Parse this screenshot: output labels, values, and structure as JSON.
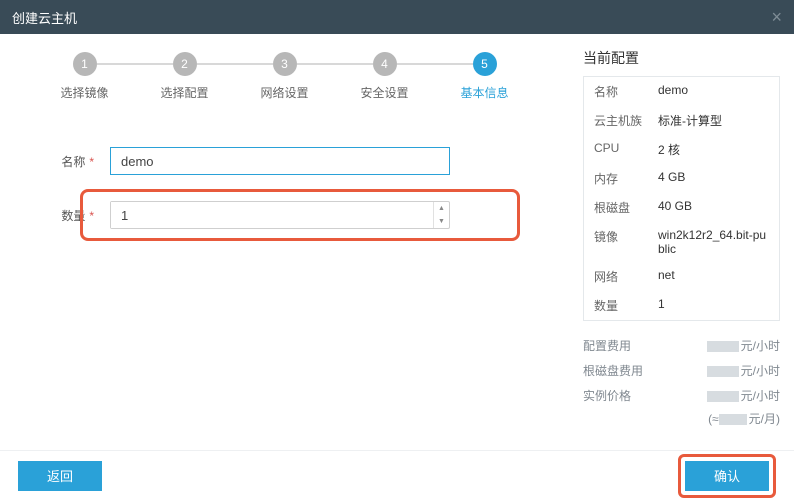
{
  "dialog": {
    "title": "创建云主机"
  },
  "steps": [
    {
      "num": "1",
      "label": "选择镜像"
    },
    {
      "num": "2",
      "label": "选择配置"
    },
    {
      "num": "3",
      "label": "网络设置"
    },
    {
      "num": "4",
      "label": "安全设置"
    },
    {
      "num": "5",
      "label": "基本信息"
    }
  ],
  "form": {
    "name_label": "名称",
    "name_value": "demo",
    "qty_label": "数量",
    "qty_value": "1"
  },
  "side": {
    "title": "当前配置",
    "rows": [
      {
        "k": "名称",
        "v": "demo"
      },
      {
        "k": "云主机族",
        "v": "标准-计算型"
      },
      {
        "k": "CPU",
        "v": "2 核"
      },
      {
        "k": "内存",
        "v": "4 GB"
      },
      {
        "k": "根磁盘",
        "v": "40 GB"
      },
      {
        "k": "镜像",
        "v": "win2k12r2_64.bit-public"
      },
      {
        "k": "网络",
        "v": "net"
      },
      {
        "k": "数量",
        "v": "1"
      }
    ],
    "pricing": {
      "config_label": "配置费用",
      "disk_label": "根磁盘费用",
      "total_label": "实例价格",
      "unit_hour": "元/小时",
      "unit_month": "元/月"
    }
  },
  "footer": {
    "back": "返回",
    "confirm": "确认"
  }
}
